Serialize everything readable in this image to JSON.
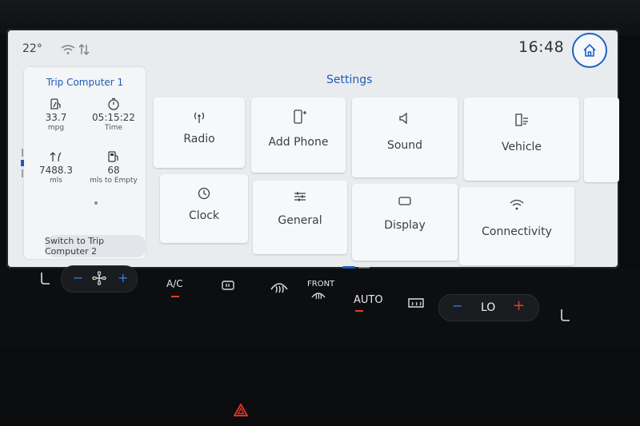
{
  "status": {
    "temperature": "22°",
    "time": "16:48"
  },
  "trip": {
    "title": "Trip Computer 1",
    "metrics": [
      {
        "value": "33.7",
        "unit": "mpg",
        "icon": "fuel-economy-icon"
      },
      {
        "value": "05:15:22",
        "unit": "Time",
        "icon": "stopwatch-icon"
      },
      {
        "value": "7488.3",
        "unit": "mls",
        "icon": "distance-icon"
      },
      {
        "value": "68",
        "unit": "mls to Empty",
        "icon": "fuel-pump-icon"
      }
    ],
    "switch_label": "Switch to Trip Computer 2"
  },
  "settings": {
    "title": "Settings",
    "tiles": [
      {
        "label": "Radio",
        "icon": "radio-icon"
      },
      {
        "label": "Add Phone",
        "icon": "phone-add-icon"
      },
      {
        "label": "Sound",
        "icon": "speaker-icon"
      },
      {
        "label": "Vehicle",
        "icon": "vehicle-settings-icon"
      },
      {
        "label": "Clock",
        "icon": "clock-icon"
      },
      {
        "label": "General",
        "icon": "sliders-icon"
      },
      {
        "label": "Display",
        "icon": "display-icon"
      },
      {
        "label": "Connectivity",
        "icon": "wifi-icon"
      }
    ]
  },
  "climate": {
    "ac_label": "A/C",
    "front_label": "FRONT",
    "auto_label": "AUTO",
    "temp_value": "LO"
  },
  "colors": {
    "accent": "#1b5cb8",
    "orange": "#e2411f",
    "screen_bg": "#e9ecef"
  }
}
